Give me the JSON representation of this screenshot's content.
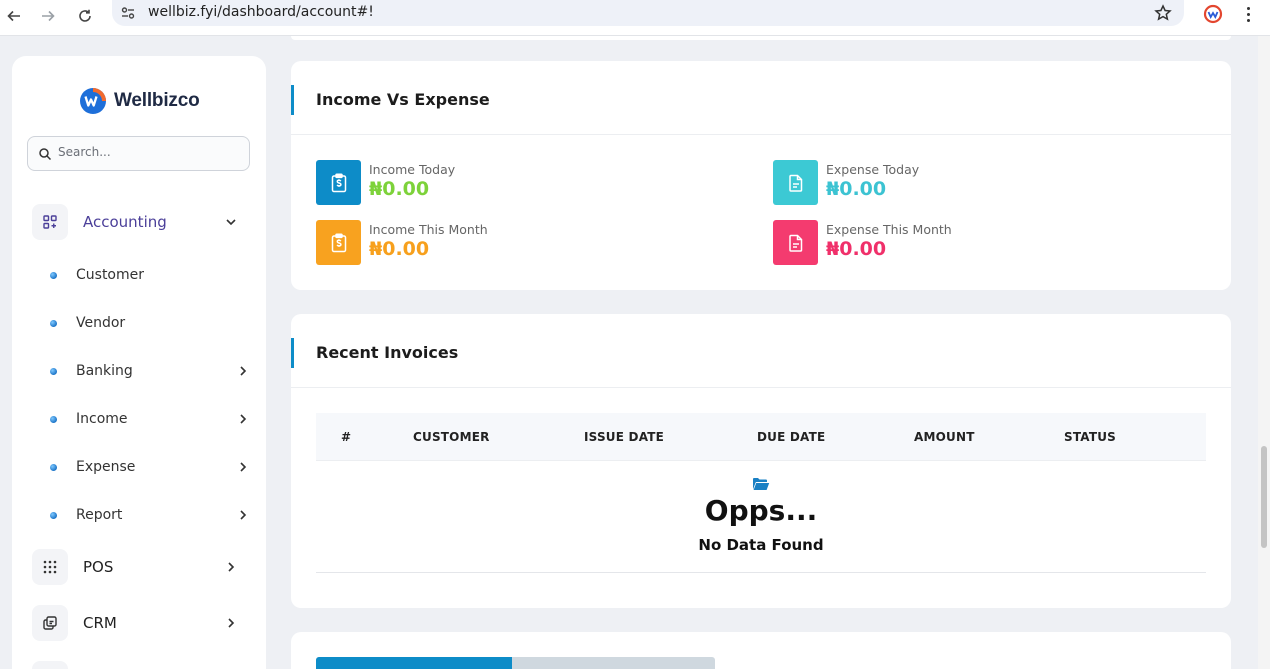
{
  "browser": {
    "url": "wellbiz.fyi/dashboard/account#!"
  },
  "sidebar": {
    "brand": "Wellbizco",
    "search_placeholder": "Search...",
    "accounting_label": "Accounting",
    "sub_items": [
      {
        "label": "Customer"
      },
      {
        "label": "Vendor"
      },
      {
        "label": "Banking"
      },
      {
        "label": "Income"
      },
      {
        "label": "Expense"
      },
      {
        "label": "Report"
      }
    ],
    "pos_label": "POS",
    "crm_label": "CRM"
  },
  "income_vs_expense": {
    "title": "Income Vs Expense",
    "stats": [
      {
        "label": "Income Today",
        "value": "₦0.00",
        "color": "#7dd23a",
        "box_color": "#0d8cc8"
      },
      {
        "label": "Expense Today",
        "value": "₦0.00",
        "color": "#3cc3d2",
        "box_color": "#3cc9d4"
      },
      {
        "label": "Income This Month",
        "value": "₦0.00",
        "color": "#f7a01d",
        "box_color": "#f8a21f"
      },
      {
        "label": "Expense This Month",
        "value": "₦0.00",
        "color": "#f0306a",
        "box_color": "#f43b6f"
      }
    ]
  },
  "recent_invoices": {
    "title": "Recent Invoices",
    "columns": [
      "#",
      "CUSTOMER",
      "ISSUE DATE",
      "DUE DATE",
      "AMOUNT",
      "STATUS"
    ],
    "empty_title": "Opps...",
    "empty_message": "No Data Found"
  },
  "bottom_card": {
    "progress_fraction": 0.49
  },
  "colors": {
    "accent": "#0d8cc8",
    "active_menu": "#4b3f99"
  }
}
